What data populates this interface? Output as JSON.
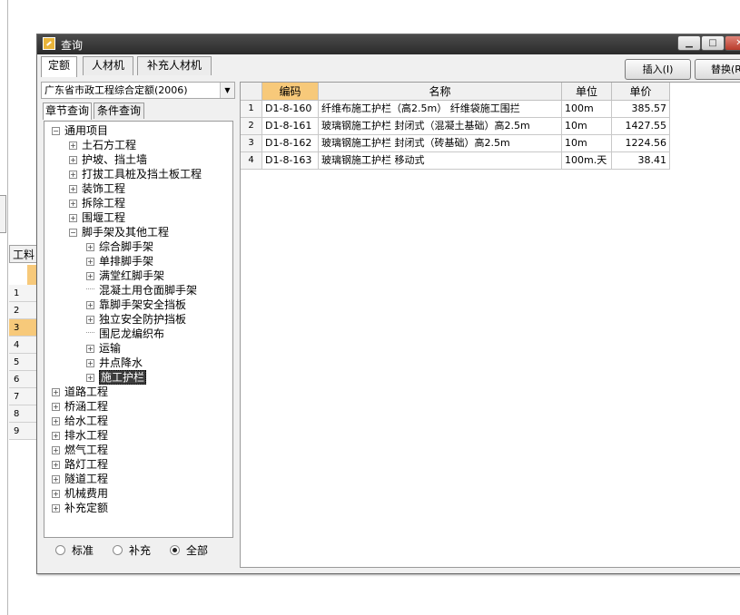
{
  "window": {
    "title": "查询"
  },
  "background": {
    "grid_header": "工料",
    "row_numbers": [
      "1",
      "2",
      "3",
      "4",
      "5",
      "6",
      "7",
      "8",
      "9"
    ]
  },
  "tabs": [
    {
      "label": "定额",
      "active": true
    },
    {
      "label": "人材机",
      "active": false
    },
    {
      "label": "补充人材机",
      "active": false
    }
  ],
  "buttons": {
    "insert": "插入(I)",
    "replace": "替换(R)"
  },
  "quota_select": {
    "value": "广东省市政工程综合定额(2006)"
  },
  "subtabs": [
    {
      "label": "章节查询",
      "active": true
    },
    {
      "label": "条件查询",
      "active": false
    }
  ],
  "tree": [
    {
      "label": "通用项目",
      "level": 0,
      "expander": "−"
    },
    {
      "label": "土石方工程",
      "level": 1,
      "expander": "+"
    },
    {
      "label": "护坡、挡土墙",
      "level": 1,
      "expander": "+"
    },
    {
      "label": "打拔工具桩及挡土板工程",
      "level": 1,
      "expander": "+"
    },
    {
      "label": "装饰工程",
      "level": 1,
      "expander": "+"
    },
    {
      "label": "拆除工程",
      "level": 1,
      "expander": "+"
    },
    {
      "label": "围堰工程",
      "level": 1,
      "expander": "+"
    },
    {
      "label": "脚手架及其他工程",
      "level": 1,
      "expander": "−"
    },
    {
      "label": "综合脚手架",
      "level": 2,
      "expander": "+"
    },
    {
      "label": "单排脚手架",
      "level": 2,
      "expander": "+"
    },
    {
      "label": "满堂红脚手架",
      "level": 2,
      "expander": "+"
    },
    {
      "label": "混凝土用仓面脚手架",
      "level": 2,
      "expander": ""
    },
    {
      "label": "靠脚手架安全挡板",
      "level": 2,
      "expander": "+"
    },
    {
      "label": "独立安全防护挡板",
      "level": 2,
      "expander": "+"
    },
    {
      "label": "围尼龙编织布",
      "level": 2,
      "expander": ""
    },
    {
      "label": "运输",
      "level": 2,
      "expander": "+"
    },
    {
      "label": "井点降水",
      "level": 2,
      "expander": "+"
    },
    {
      "label": "施工护栏",
      "level": 2,
      "expander": "+",
      "selected": true
    },
    {
      "label": "道路工程",
      "level": 0,
      "expander": "+"
    },
    {
      "label": "桥涵工程",
      "level": 0,
      "expander": "+"
    },
    {
      "label": "给水工程",
      "level": 0,
      "expander": "+"
    },
    {
      "label": "排水工程",
      "level": 0,
      "expander": "+"
    },
    {
      "label": "燃气工程",
      "level": 0,
      "expander": "+"
    },
    {
      "label": "路灯工程",
      "level": 0,
      "expander": "+"
    },
    {
      "label": "隧道工程",
      "level": 0,
      "expander": "+"
    },
    {
      "label": "机械费用",
      "level": 0,
      "expander": "+"
    },
    {
      "label": "补充定额",
      "level": 0,
      "expander": "+"
    }
  ],
  "filter": [
    {
      "label": "标准",
      "checked": false
    },
    {
      "label": "补充",
      "checked": false
    },
    {
      "label": "全部",
      "checked": true
    }
  ],
  "table": {
    "columns": [
      "",
      "编码",
      "名称",
      "单位",
      "单价"
    ],
    "rows": [
      {
        "no": "1",
        "code": "D1-8-160",
        "name": "纤维布施工护栏（高2.5m） 纤维袋施工围拦",
        "unit": "100m",
        "price": "385.57"
      },
      {
        "no": "2",
        "code": "D1-8-161",
        "name": "玻璃钢施工护栏 封闭式（混凝土基础）高2.5m",
        "unit": "10m",
        "price": "1427.55"
      },
      {
        "no": "3",
        "code": "D1-8-162",
        "name": "玻璃钢施工护栏 封闭式（砖基础）高2.5m",
        "unit": "10m",
        "price": "1224.56"
      },
      {
        "no": "4",
        "code": "D1-8-163",
        "name": "玻璃钢施工护栏 移动式",
        "unit": "100m.天",
        "price": "38.41"
      }
    ]
  },
  "colors": {
    "selected_header": "#f7c97a",
    "titlebar": "#3a3a3a"
  }
}
